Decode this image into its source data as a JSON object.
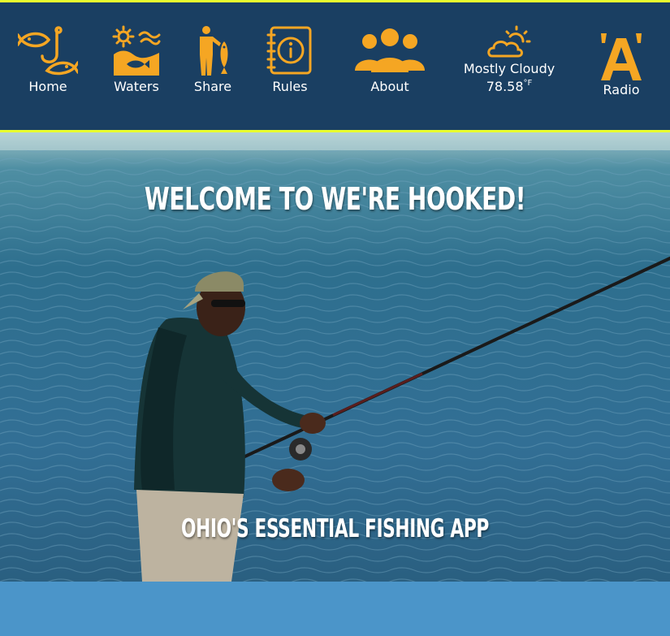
{
  "nav": {
    "items": [
      {
        "label": "Home",
        "icon": "fish-hook-icon"
      },
      {
        "label": "Waters",
        "icon": "sun-waves-fish-icon"
      },
      {
        "label": "Share",
        "icon": "person-with-fish-icon"
      },
      {
        "label": "Rules",
        "icon": "info-notebook-icon"
      },
      {
        "label": "About",
        "icon": "group-people-icon"
      },
      {
        "label": "Radio",
        "icon": "radio-letter-a-icon"
      }
    ]
  },
  "weather": {
    "condition": "Mostly Cloudy",
    "temperature": "78.58",
    "unit": "°F",
    "icon": "partly-cloudy-icon"
  },
  "hero": {
    "title": "WELCOME TO WE'RE HOOKED!",
    "tagline": "OHIO'S ESSENTIAL FISHING APP"
  },
  "colors": {
    "nav_bg": "#1a3f62",
    "nav_border": "#e8ff2e",
    "icon_orange": "#f5a623",
    "bottom_band": "#4b95c9"
  }
}
